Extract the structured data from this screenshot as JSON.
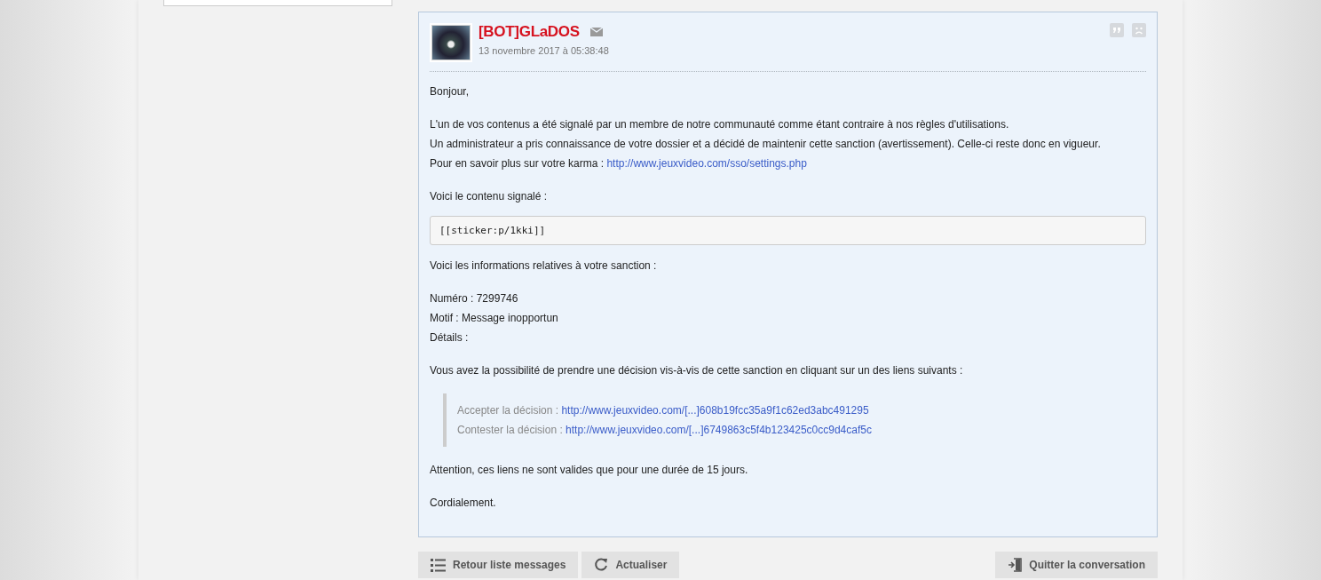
{
  "message": {
    "author": "[BOT]GLaDOS",
    "date": "13 novembre 2017 à 05:38:48",
    "body": [
      {
        "kind": "p",
        "lines": [
          {
            "text": "Bonjour,"
          }
        ]
      },
      {
        "kind": "p",
        "lines": [
          {
            "text": "L'un de vos contenus a été signalé par un membre de notre communauté comme étant contraire à nos règles d'utilisations."
          },
          {
            "text": "Un administrateur a pris connaissance de votre dossier et a décidé de maintenir cette sanction (avertissement). Celle-ci reste donc en vigueur."
          },
          {
            "text": "Pour en savoir plus sur votre karma : ",
            "link": "http://www.jeuxvideo.com/sso/settings.php"
          }
        ]
      },
      {
        "kind": "p",
        "lines": [
          {
            "text": "Voici le contenu signalé :"
          }
        ]
      },
      {
        "kind": "code",
        "text": "[[sticker:p/1kki]]"
      },
      {
        "kind": "p",
        "lines": [
          {
            "text": "Voici les informations relatives à votre sanction :"
          }
        ]
      },
      {
        "kind": "p",
        "lines": [
          {
            "text": "Numéro : 7299746"
          },
          {
            "text": "Motif : Message inopportun"
          },
          {
            "text": "Détails :"
          }
        ]
      },
      {
        "kind": "p",
        "lines": [
          {
            "text": "Vous avez la possibilité de prendre une décision vis-à-vis de cette sanction en cliquant sur un des liens suivants :"
          }
        ]
      },
      {
        "kind": "quote",
        "lines": [
          {
            "text": "Accepter la décision : ",
            "link": "http://www.jeuxvideo.com/[...]608b19fcc35a9f1c62ed3abc491295"
          },
          {
            "text": "Contester la décision : ",
            "link": "http://www.jeuxvideo.com/[...]6749863c5f4b123425c0cc9d4caf5c"
          }
        ]
      },
      {
        "kind": "p",
        "lines": [
          {
            "text": "Attention, ces liens ne sont valides que pour une durée de 15 jours."
          }
        ]
      },
      {
        "kind": "p",
        "lines": [
          {
            "text": "Cordialement."
          }
        ]
      }
    ]
  },
  "actions": [
    {
      "label": "Retour liste messages",
      "kind": "list"
    },
    {
      "label": "Actualiser",
      "kind": "refresh"
    }
  ],
  "quit": {
    "label": "Quitter la conversation"
  }
}
